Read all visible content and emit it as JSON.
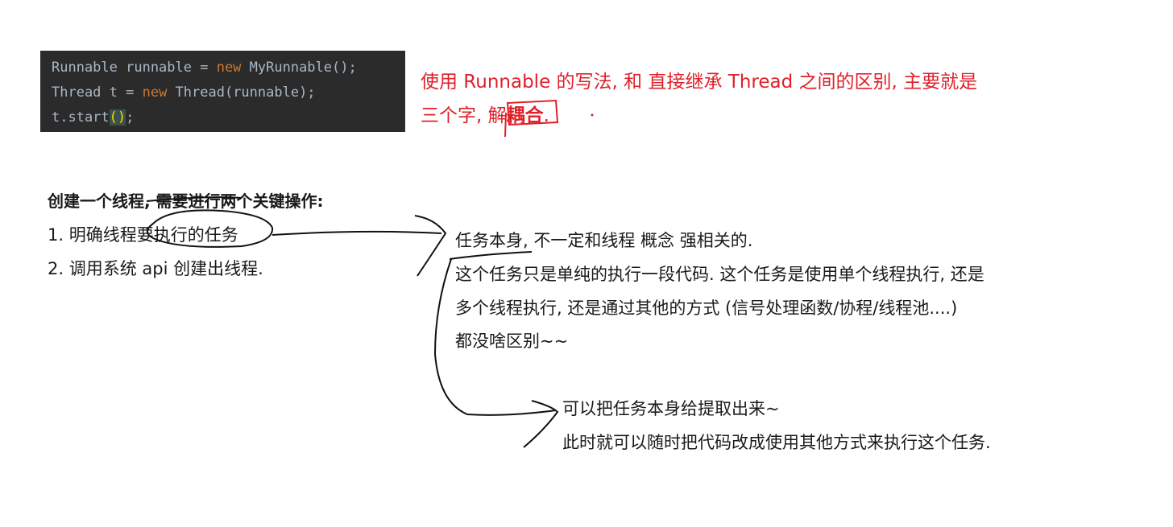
{
  "code": {
    "line1_a": "Runnable runnable = ",
    "line1_kw": "new",
    "line1_b": " MyRunnable();",
    "line2_a": "Thread t = ",
    "line2_kw": "new",
    "line2_b": " Thread(runnable);",
    "line3_a": "t.start",
    "line3_paren": "()",
    "line3_b": ";"
  },
  "note": {
    "line1": "使用 Runnable 的写法, 和 直接继承 Thread 之间的区别, 主要就是",
    "line2_prefix": "三个字, 解",
    "line2_bold": "耦合",
    "line2_suffix": "."
  },
  "section": {
    "heading": "创建一个线程, 需要进行两个关键操作:",
    "step1": "1. 明确线程要执行的任务",
    "step2": "2. 调用系统 api 创建出线程."
  },
  "explain": {
    "line1": "任务本身, 不一定和线程 概念 强相关的.",
    "line2": "这个任务只是单纯的执行一段代码. 这个任务是使用单个线程执行, 还是",
    "line3": "多个线程执行, 还是通过其他的方式 (信号处理函数/协程/线程池....)",
    "line4": "都没啥区别~~"
  },
  "extract": {
    "line1": "可以把任务本身给提取出来~",
    "line2": "此时就可以随时把代码改成使用其他方式来执行这个任务."
  },
  "colors": {
    "red": "#e0202a",
    "code_bg": "#2b2b2b",
    "keyword": "#cc7832"
  }
}
